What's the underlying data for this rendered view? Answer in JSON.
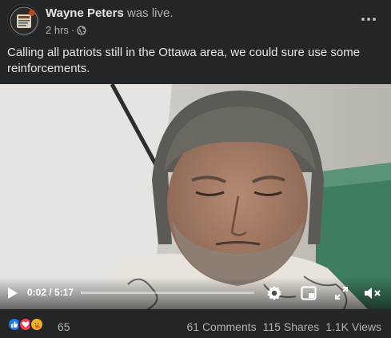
{
  "post": {
    "author": "Wayne Peters",
    "status_text": " was live.",
    "timestamp": "2 hrs",
    "separator": "·",
    "privacy_icon": "globe-icon",
    "more_icon": "more-options-icon",
    "caption": "Calling all patriots still in the Ottawa area, we could sure use some reinforcements."
  },
  "video": {
    "time_current": "0:02",
    "time_total": "5:17",
    "time_display": "0:02 / 5:17",
    "progress_fraction": 0.006,
    "icons": {
      "play": "play-icon",
      "settings": "gear-icon",
      "pip": "picture-in-picture-icon",
      "fullscreen": "fullscreen-icon",
      "volume": "volume-muted-icon"
    }
  },
  "footer": {
    "reaction_icons": [
      "like-icon",
      "love-icon",
      "care-icon"
    ],
    "reaction_count": "65",
    "comments": "61 Comments",
    "shares": "115 Shares",
    "views": "1.1K Views"
  },
  "colors": {
    "background": "#242526",
    "text_primary": "#e4e6eb",
    "text_secondary": "#b0b3b8",
    "like_blue": "#1877f2",
    "love_red": "#f33e58",
    "care_yellow": "#f7b125"
  }
}
